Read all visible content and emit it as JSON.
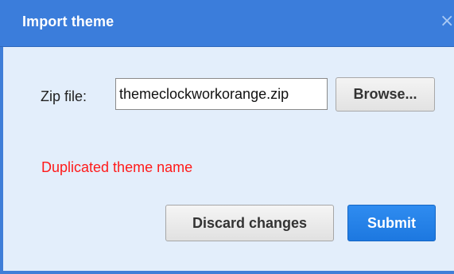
{
  "dialog": {
    "title": "Import theme",
    "close_icon": "close-icon",
    "zip_label": "Zip file:",
    "zip_value": "themeclockworkorange.zip",
    "browse_label": "Browse...",
    "error_text": "Duplicated theme name",
    "discard_label": "Discard changes",
    "submit_label": "Submit"
  },
  "colors": {
    "titlebar": "#3b7ddb",
    "body": "#e3eefb",
    "error": "#ff1a1a",
    "primary_button": "#1d78e0"
  }
}
